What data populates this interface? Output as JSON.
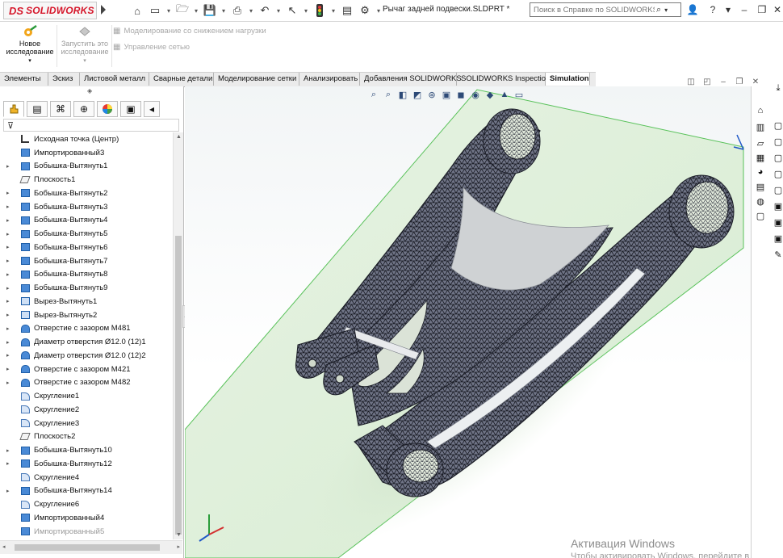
{
  "app": {
    "logo_ds": "DS",
    "logo_text": "SOLIDWORKS",
    "doc_title": "Рычаг задней подвески.SLDPRT *",
    "help_search_placeholder": "Поиск в Справке по SOLIDWORKS"
  },
  "command_manager": {
    "new_study": "Новое исследование",
    "run_study": "Запустить это исследование",
    "load_reduction": "Моделирование со снижением нагрузки",
    "network": "Управление сетью"
  },
  "tabs": [
    {
      "label": "Элементы"
    },
    {
      "label": "Эскиз"
    },
    {
      "label": "Листовой металл"
    },
    {
      "label": "Сварные детали"
    },
    {
      "label": "Моделирование сетки"
    },
    {
      "label": "Анализировать"
    },
    {
      "label": "Добавления SOLIDWORKS"
    },
    {
      "label": "SOLIDWORKS Inspection"
    },
    {
      "label": "Simulation"
    }
  ],
  "feature_tree": [
    {
      "label": "Исходная точка (Центр)",
      "icon": "origin-icon",
      "expandable": false
    },
    {
      "label": "Импортированный3",
      "icon": "imported-icon",
      "expandable": false
    },
    {
      "label": "Бобышка-Вытянуть1",
      "icon": "boss-extrude-icon",
      "expandable": true
    },
    {
      "label": "Плоскость1",
      "icon": "plane-icon",
      "expandable": false
    },
    {
      "label": "Бобышка-Вытянуть2",
      "icon": "boss-extrude-icon",
      "expandable": true
    },
    {
      "label": "Бобышка-Вытянуть3",
      "icon": "boss-extrude-icon",
      "expandable": true
    },
    {
      "label": "Бобышка-Вытянуть4",
      "icon": "boss-extrude-icon",
      "expandable": true
    },
    {
      "label": "Бобышка-Вытянуть5",
      "icon": "boss-extrude-icon",
      "expandable": true
    },
    {
      "label": "Бобышка-Вытянуть6",
      "icon": "boss-extrude-icon",
      "expandable": true
    },
    {
      "label": "Бобышка-Вытянуть7",
      "icon": "boss-extrude-icon",
      "expandable": true
    },
    {
      "label": "Бобышка-Вытянуть8",
      "icon": "boss-extrude-icon",
      "expandable": true
    },
    {
      "label": "Бобышка-Вытянуть9",
      "icon": "boss-extrude-icon",
      "expandable": true
    },
    {
      "label": "Вырез-Вытянуть1",
      "icon": "cut-extrude-icon",
      "expandable": true
    },
    {
      "label": "Вырез-Вытянуть2",
      "icon": "cut-extrude-icon",
      "expandable": true
    },
    {
      "label": "Отверстие с зазором M481",
      "icon": "hole-icon",
      "expandable": true
    },
    {
      "label": "Диаметр отверстия Ø12.0 (12)1",
      "icon": "hole-icon",
      "expandable": true
    },
    {
      "label": "Диаметр отверстия Ø12.0 (12)2",
      "icon": "hole-icon",
      "expandable": true
    },
    {
      "label": "Отверстие с зазором M421",
      "icon": "hole-icon",
      "expandable": true
    },
    {
      "label": "Отверстие с зазором M482",
      "icon": "hole-icon",
      "expandable": true
    },
    {
      "label": "Скругление1",
      "icon": "fillet-icon",
      "expandable": false
    },
    {
      "label": "Скругление2",
      "icon": "fillet-icon",
      "expandable": false
    },
    {
      "label": "Скругление3",
      "icon": "fillet-icon",
      "expandable": false
    },
    {
      "label": "Плоскость2",
      "icon": "plane-icon",
      "expandable": false
    },
    {
      "label": "Бобышка-Вытянуть10",
      "icon": "boss-extrude-icon",
      "expandable": true
    },
    {
      "label": "Бобышка-Вытянуть12",
      "icon": "boss-extrude-icon",
      "expandable": true
    },
    {
      "label": "Скругление4",
      "icon": "fillet-icon",
      "expandable": false
    },
    {
      "label": "Бобышка-Вытянуть14",
      "icon": "boss-extrude-icon",
      "expandable": true
    },
    {
      "label": "Скругление6",
      "icon": "fillet-icon",
      "expandable": false
    },
    {
      "label": "Импортированный4",
      "icon": "imported-icon",
      "expandable": false
    },
    {
      "label": "Импортированный5",
      "icon": "imported-icon",
      "expandable": false,
      "faded": true
    }
  ],
  "watermark": {
    "line1": "Активация Windows",
    "line2": "Чтобы активировать Windows, перейдите в"
  },
  "colors": {
    "brand": "#d6172b",
    "mesh_plane": "#dff0dc",
    "mesh_lines": "#2a2c3a"
  }
}
